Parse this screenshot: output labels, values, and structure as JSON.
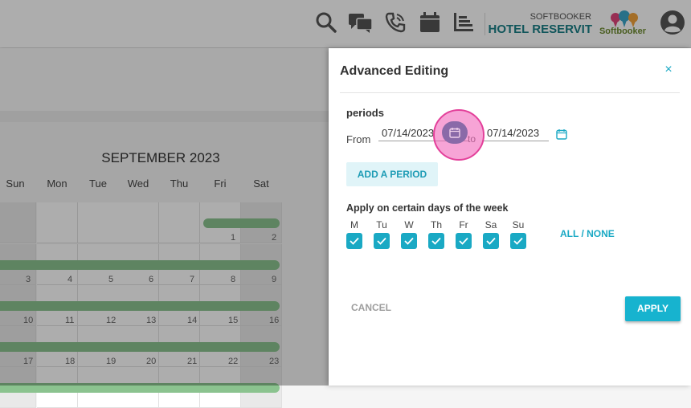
{
  "header": {
    "brand_small": "SOFTBOOKER",
    "brand_name": "HOTEL RESERVIT",
    "logo_text": "Softbooker",
    "icons": [
      "search-icon",
      "chat-icon",
      "phone-icon",
      "calendar-icon",
      "report-icon",
      "user-avatar-icon"
    ]
  },
  "calendar": {
    "title": "SEPTEMBER 2023",
    "days_of_week": [
      "Sun",
      "Mon",
      "Tue",
      "Wed",
      "Thu",
      "Fri",
      "Sat"
    ],
    "day_numbers": [
      "1",
      "2",
      "3",
      "4",
      "5",
      "6",
      "7",
      "8",
      "9",
      "10",
      "11",
      "12",
      "13",
      "14",
      "15",
      "16",
      "17",
      "18",
      "19",
      "20",
      "21",
      "22",
      "23"
    ]
  },
  "panel": {
    "title": "Advanced Editing",
    "close_label": "×",
    "periods_label": "periods",
    "from_label": "From",
    "from_value": "07/14/2023",
    "to_label": "to",
    "to_value": "07/14/2023",
    "add_period_label": "ADD A PERIOD",
    "days_label": "Apply on certain days of the week",
    "weekdays": [
      {
        "letter": "M",
        "checked": true
      },
      {
        "letter": "Tu",
        "checked": true
      },
      {
        "letter": "W",
        "checked": true
      },
      {
        "letter": "Th",
        "checked": true
      },
      {
        "letter": "Fr",
        "checked": true
      },
      {
        "letter": "Sa",
        "checked": true
      },
      {
        "letter": "Su",
        "checked": true
      }
    ],
    "all_none_label": "ALL / NONE",
    "cancel_label": "CANCEL",
    "apply_label": "APPLY"
  },
  "colors": {
    "accent": "#1aa9c4",
    "brand": "#1a7f86",
    "booking_bar": "#8bc38f",
    "click_marker": "#e3409a"
  }
}
